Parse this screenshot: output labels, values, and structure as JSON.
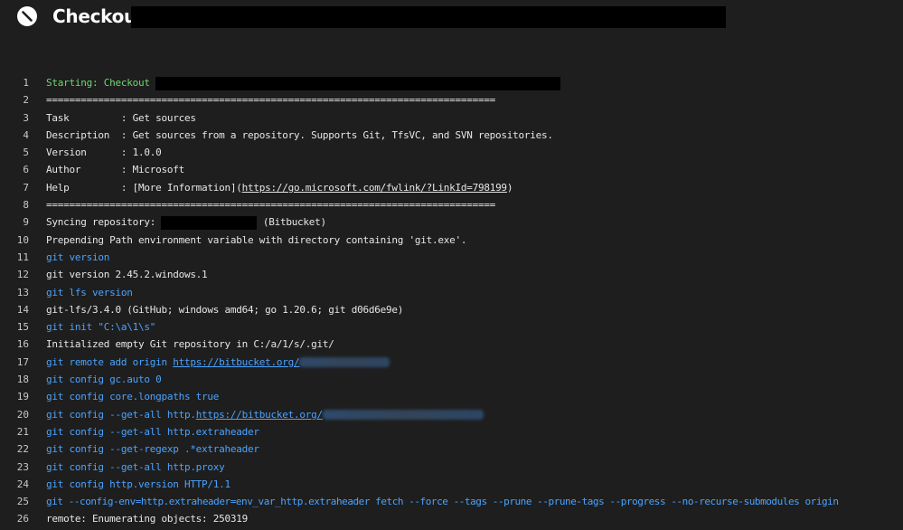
{
  "header": {
    "title": "Checkout",
    "status_icon": "cancelled-icon"
  },
  "log": {
    "lines": [
      {
        "n": "1",
        "text": "Starting: Checkout"
      },
      {
        "n": "2",
        "text": "=============================================================================="
      },
      {
        "n": "3",
        "text": "Task         : Get sources"
      },
      {
        "n": "4",
        "text": "Description  : Get sources from a repository. Supports Git, TfsVC, and SVN repositories."
      },
      {
        "n": "5",
        "text": "Version      : 1.0.0"
      },
      {
        "n": "6",
        "text": "Author       : Microsoft"
      },
      {
        "n": "7",
        "prefix": "Help         : [More Information](",
        "link": "https://go.microsoft.com/fwlink/?LinkId=798199",
        "suffix": ")"
      },
      {
        "n": "8",
        "text": "=============================================================================="
      },
      {
        "n": "9",
        "prefix": "Syncing repository: ",
        "suffix": " (Bitbucket)"
      },
      {
        "n": "10",
        "text": "Prepending Path environment variable with directory containing 'git.exe'."
      },
      {
        "n": "11",
        "text": "git version"
      },
      {
        "n": "12",
        "text": "git version 2.45.2.windows.1"
      },
      {
        "n": "13",
        "text": "git lfs version"
      },
      {
        "n": "14",
        "text": "git-lfs/3.4.0 (GitHub; windows amd64; go 1.20.6; git d06d6e9e)"
      },
      {
        "n": "15",
        "text": "git init \"C:\\a\\1\\s\""
      },
      {
        "n": "16",
        "text": "Initialized empty Git repository in C:/a/1/s/.git/"
      },
      {
        "n": "17",
        "prefix": "git remote add origin ",
        "link": "https://bitbucket.org/"
      },
      {
        "n": "18",
        "text": "git config gc.auto 0"
      },
      {
        "n": "19",
        "text": "git config core.longpaths true"
      },
      {
        "n": "20",
        "prefix": "git config --get-all http.",
        "link": "https://bitbucket.org/"
      },
      {
        "n": "21",
        "text": "git config --get-all http.extraheader"
      },
      {
        "n": "22",
        "text": "git config --get-regexp .*extraheader"
      },
      {
        "n": "23",
        "text": "git config --get-all http.proxy"
      },
      {
        "n": "24",
        "text": "git config http.version HTTP/1.1"
      },
      {
        "n": "25",
        "text": "git --config-env=http.extraheader=env_var_http.extraheader fetch --force --tags --prune --prune-tags --progress --no-recurse-submodules origin"
      },
      {
        "n": "26",
        "text": "remote: Enumerating objects: 250319"
      }
    ]
  },
  "colors": {
    "background": "#1e1e1e",
    "command": "#4aa3ff",
    "section_start": "#6fd76f",
    "text": "#e6e6e6"
  }
}
